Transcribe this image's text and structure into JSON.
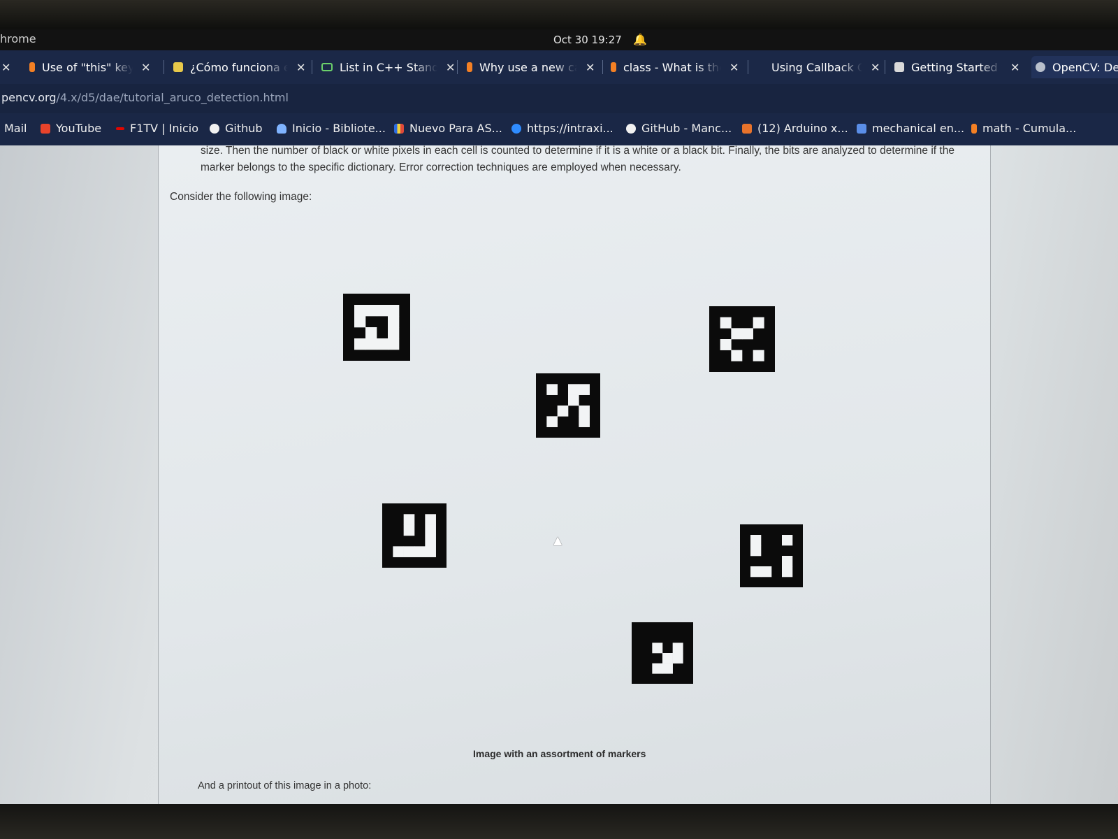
{
  "system_bar": {
    "app_name": "hrome",
    "clock": "Oct 30  19:27",
    "bell_icon": "bell-icon"
  },
  "tabs": [
    {
      "label": "Use of \"this\" keyword",
      "favicon": "stackoverflow-icon"
    },
    {
      "label": "¿Cómo funciona el",
      "favicon": "doc-icon"
    },
    {
      "label": "List in C++ Standard",
      "favicon": "cpp-icon"
    },
    {
      "label": "Why use a new call",
      "favicon": "stackoverflow-icon"
    },
    {
      "label": "class - What is the",
      "favicon": "stackoverflow-icon"
    },
    {
      "label": "Using Callback Gr",
      "favicon": ""
    },
    {
      "label": "Getting Started w",
      "favicon": "doc-icon"
    },
    {
      "label": "OpenCV: Dete",
      "favicon": "opencv-icon"
    }
  ],
  "address_bar": {
    "host": "pencv.org",
    "path": "/4.x/d5/dae/tutorial_aruco_detection.html"
  },
  "bookmarks": [
    {
      "label": "Mail",
      "icon": ""
    },
    {
      "label": "YouTube",
      "icon": "youtube-icon"
    },
    {
      "label": "F1TV | Inicio",
      "icon": "f1-icon"
    },
    {
      "label": "Github",
      "icon": "github-icon"
    },
    {
      "label": "Inicio - Bibliote...",
      "icon": "cloud-icon"
    },
    {
      "label": "Nuevo Para AS...",
      "icon": "flag-icon"
    },
    {
      "label": "https://intraxi...",
      "icon": "cloud-icon"
    },
    {
      "label": "GitHub - Manc...",
      "icon": "github-icon"
    },
    {
      "label": "(12) Arduino x...",
      "icon": "youtube-icon"
    },
    {
      "label": "mechanical en...",
      "icon": "stackexchange-icon"
    },
    {
      "label": "math - Cumula...",
      "icon": "stackoverflow-icon"
    }
  ],
  "content": {
    "paragraph_1": "size. Then the number of black or white pixels in each cell is counted to determine if it is a white or a black bit. Finally, the bits are analyzed to determine if the marker belongs to the specific dictionary. Error correction techniques are employed when necessary.",
    "paragraph_2": "Consider the following image:",
    "figure_caption": "Image with an assortment of markers",
    "paragraph_3": "And a printout of this image in a photo:"
  },
  "colors": {
    "tab_bar": "#1b2847",
    "page_bg": "#e6eaec",
    "marker": "#0b0b0b"
  },
  "markers": [
    {
      "grid": [
        "1111",
        "1001",
        "0101",
        "1111"
      ]
    },
    {
      "grid": [
        "1011",
        "0010",
        "0101",
        "1001"
      ]
    },
    {
      "grid": [
        "1001",
        "0110",
        "1000",
        "0101"
      ]
    },
    {
      "grid": [
        "0101",
        "0101",
        "0001",
        "1111"
      ]
    },
    {
      "grid": [
        "1001",
        "1000",
        "0001",
        "1101"
      ]
    },
    {
      "grid": [
        "0000",
        "0101",
        "0011",
        "0110"
      ]
    }
  ]
}
